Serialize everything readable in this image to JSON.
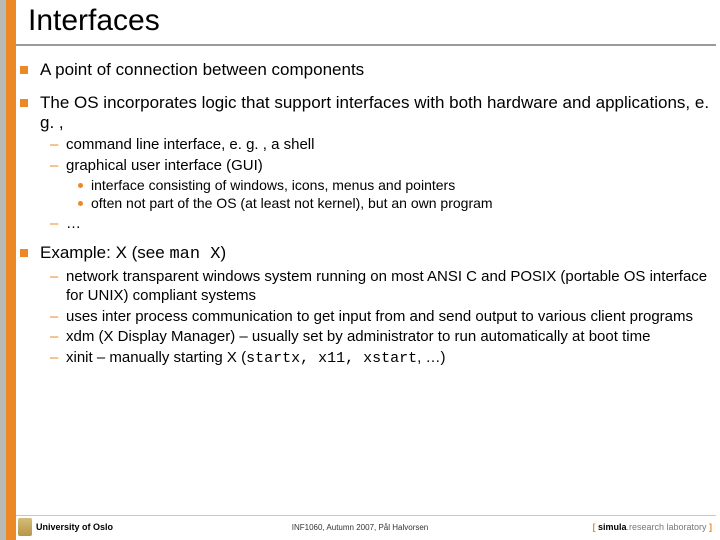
{
  "title": "Interfaces",
  "bullets": {
    "b1": "A point of connection between components",
    "b2": "The OS incorporates logic that support interfaces with both hardware and applications, e. g. ,",
    "b2_sub": {
      "s1": "command line interface, e. g. , a shell",
      "s2": "graphical user interface (GUI)",
      "s2_sub": {
        "t1": "interface consisting of windows, icons, menus and pointers",
        "t2": "often not part of the OS (at least not kernel), but an own program"
      },
      "s3": "…"
    },
    "b3_pre": "Example: X (see ",
    "b3_code": "man X",
    "b3_post": ")",
    "b3_sub": {
      "s1": "network transparent windows system running on most ANSI C and POSIX (portable OS interface for UNIX) compliant systems",
      "s2": "uses inter process communication to get input from and send output to various client programs",
      "s3": "xdm (X Display Manager) – usually set by administrator to run automatically at boot time",
      "s4_pre": "xinit – manually starting X (",
      "s4_code": "startx, x11, xstart",
      "s4_post": ", …)"
    }
  },
  "footer": {
    "left": "University of Oslo",
    "mid": "INF1060, Autumn 2007, Pål Halvorsen",
    "r_bracket_open": "[ ",
    "r_word1": "simula",
    "r_word2": ".research laboratory",
    "r_bracket_close": " ]"
  }
}
